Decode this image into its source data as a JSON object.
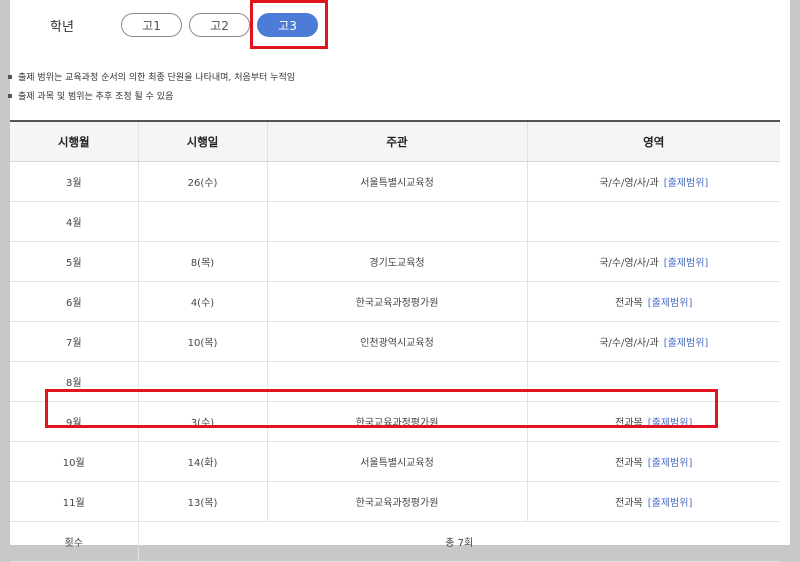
{
  "grade": {
    "label": "학년",
    "options": [
      "고1",
      "고2",
      "고3"
    ],
    "selected": "고3"
  },
  "notes": [
    "출제 범위는 교육과정 순서의 의한 최종 단원을 나타내며, 처음부터 누적임",
    "출제 과목 및 범위는 추후 조정 될 수 있음"
  ],
  "table": {
    "headers": [
      "시행월",
      "시행일",
      "주관",
      "영역"
    ],
    "rows": [
      {
        "month": "3월",
        "day": "26(수)",
        "org": "서울특별시교육청",
        "area": "국/수/영/사/과",
        "link": "[출제범위]"
      },
      {
        "month": "4월",
        "day": "",
        "org": "",
        "area": "",
        "link": ""
      },
      {
        "month": "5월",
        "day": "8(목)",
        "org": "경기도교육청",
        "area": "국/수/영/사/과",
        "link": "[출제범위]"
      },
      {
        "month": "6월",
        "day": "4(수)",
        "org": "한국교육과정평가원",
        "area": "전과목",
        "link": "[출제범위]"
      },
      {
        "month": "7월",
        "day": "10(목)",
        "org": "인천광역시교육청",
        "area": "국/수/영/사/과",
        "link": "[출제범위]"
      },
      {
        "month": "8월",
        "day": "",
        "org": "",
        "area": "",
        "link": ""
      },
      {
        "month": "9월",
        "day": "3(수)",
        "org": "한국교육과정평가원",
        "area": "전과목",
        "link": "[출제범위]"
      },
      {
        "month": "10월",
        "day": "14(화)",
        "org": "서울특별시교육청",
        "area": "전과목",
        "link": "[출제범위]"
      },
      {
        "month": "11월",
        "day": "13(목)",
        "org": "한국교육과정평가원",
        "area": "전과목",
        "link": "[출제범위]"
      }
    ],
    "total_label": "횟수",
    "total_value": "총 7회"
  },
  "colors": {
    "accent": "#4d7bd8",
    "highlight": "#e0141e",
    "link": "#4a6fc4"
  }
}
